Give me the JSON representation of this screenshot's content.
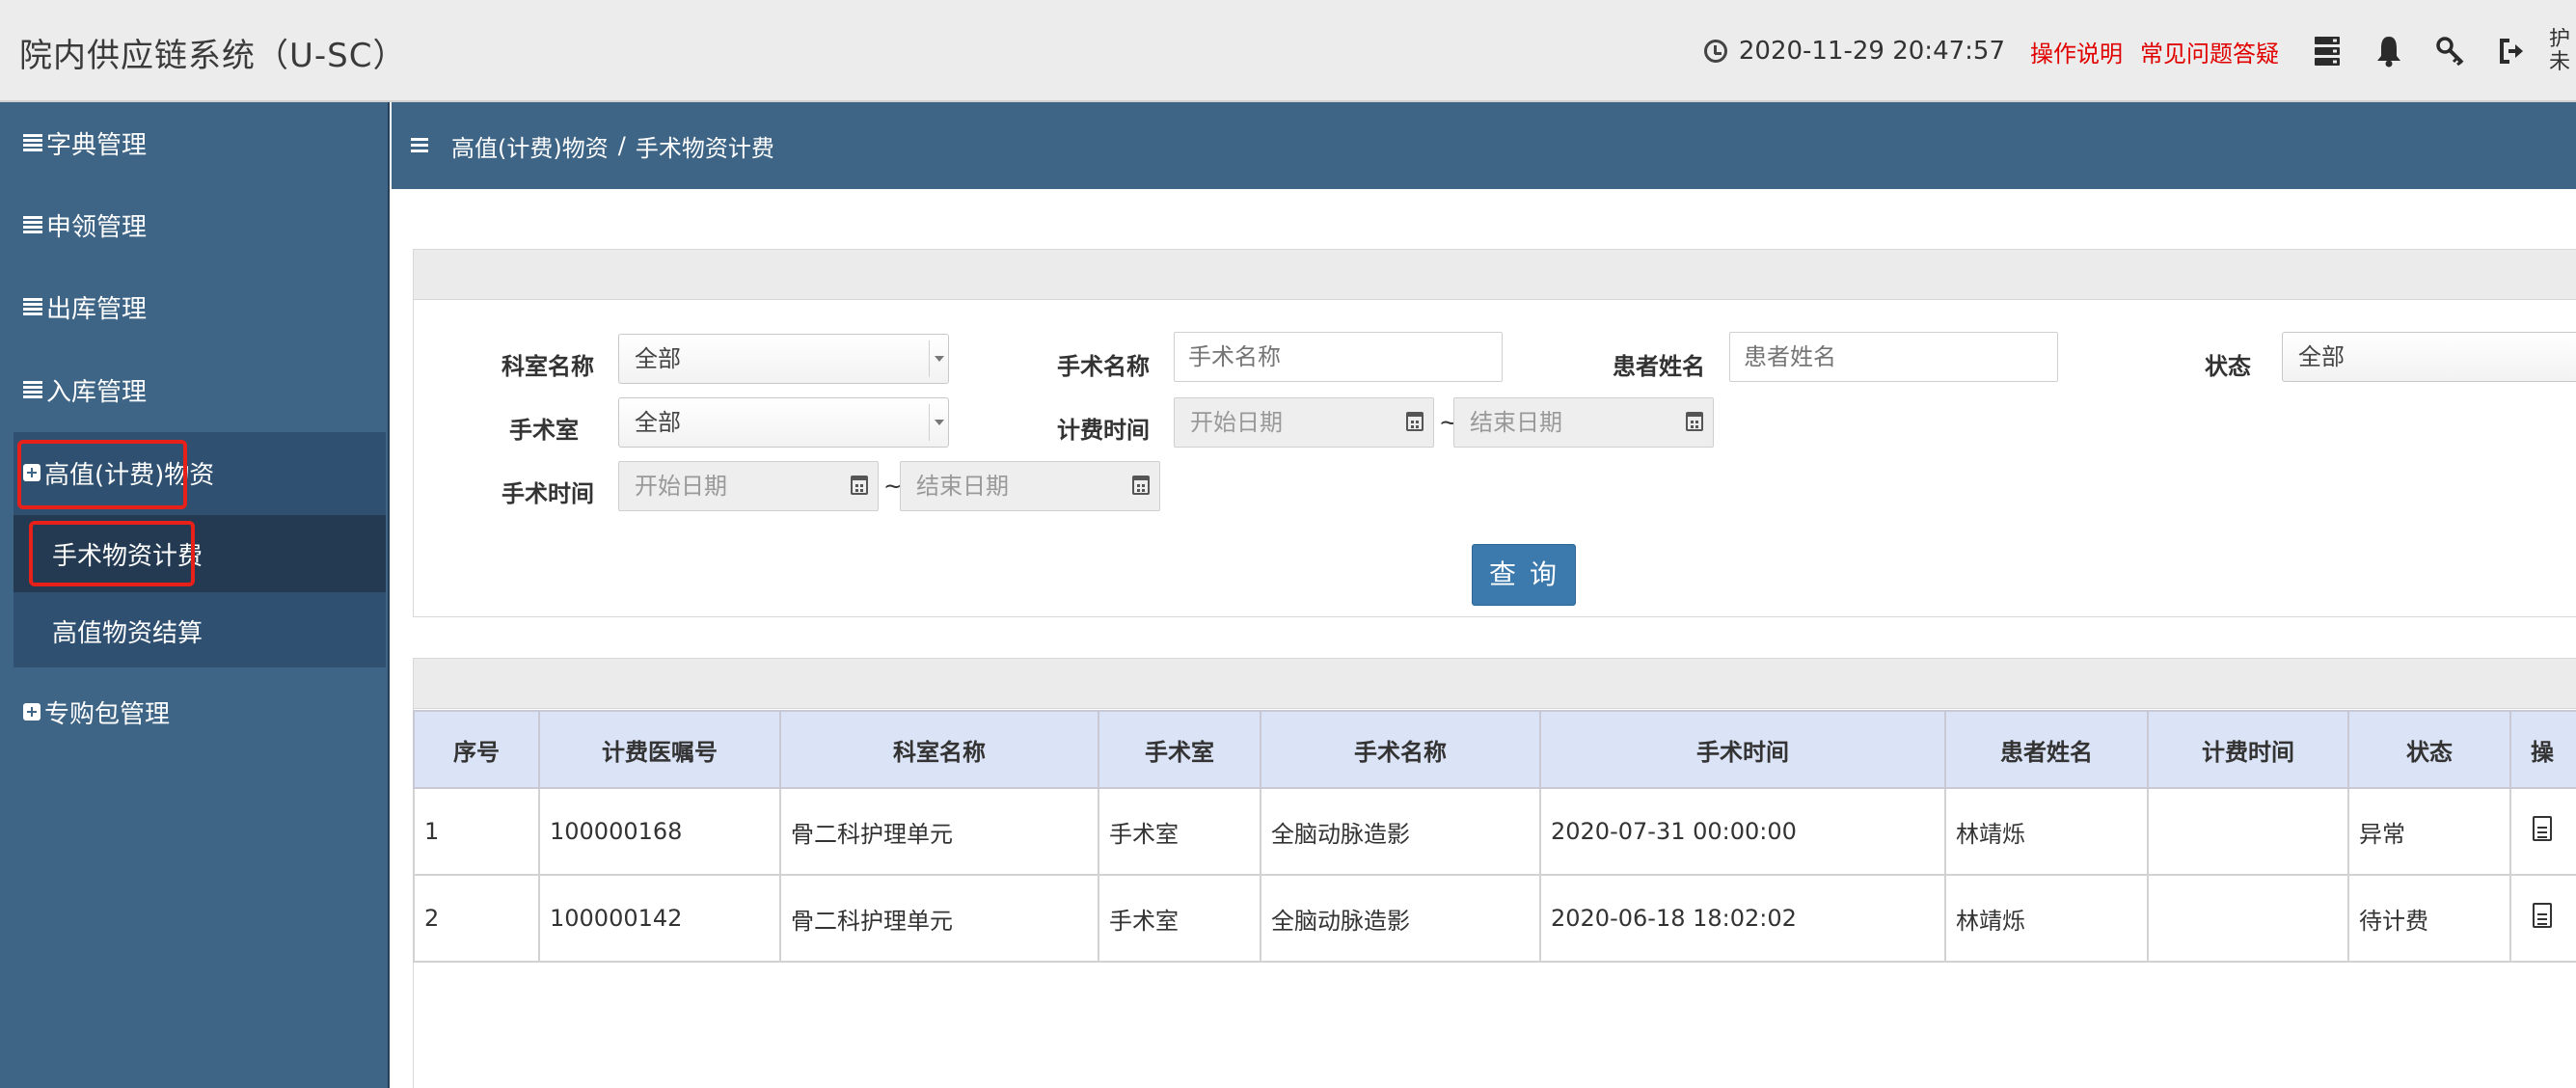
{
  "header": {
    "app_title": "院内供应链系统（U-SC）",
    "datetime": "2020-11-29  20:47:57",
    "help_link": "操作说明",
    "faq_link": "常见问题答疑",
    "user_tail": "护 未",
    "icons": [
      "clock-icon",
      "server-icon",
      "bell-icon",
      "key-icon",
      "logout-icon"
    ]
  },
  "sidebar": {
    "items": [
      {
        "label": "字典管理"
      },
      {
        "label": "申领管理"
      },
      {
        "label": "出库管理"
      },
      {
        "label": "入库管理"
      },
      {
        "label": "高值(计费)物资"
      },
      {
        "label": "手术物资计费"
      },
      {
        "label": "高值物资结算"
      },
      {
        "label": "专购包管理"
      }
    ]
  },
  "breadcrumb": {
    "parent": "高值(计费)物资",
    "separator": "/",
    "current": "手术物资计费"
  },
  "filters": {
    "dept_label": "科室名称",
    "dept_value": "全部",
    "surgery_name_label": "手术名称",
    "surgery_name_placeholder": "手术名称",
    "patient_label": "患者姓名",
    "patient_placeholder": "患者姓名",
    "status_label": "状态",
    "status_value": "全部",
    "or_label": "手术室",
    "or_value": "全部",
    "billing_time_label": "计费时间",
    "billing_start": "开始日期",
    "billing_end": "结束日期",
    "surgery_time_label": "手术时间",
    "surgery_start": "开始日期",
    "surgery_end": "结束日期",
    "range_sep": "~",
    "query_button": "查询"
  },
  "table": {
    "columns": [
      "序号",
      "计费医嘱号",
      "科室名称",
      "手术室",
      "手术名称",
      "手术时间",
      "患者姓名",
      "计费时间",
      "状态",
      "操"
    ],
    "rows": [
      [
        "1",
        "100000168",
        "骨二科护理单元",
        "手术室",
        "全脑动脉造影",
        "2020-07-31 00:00:00",
        "林靖烁",
        "",
        "异常"
      ],
      [
        "2",
        "100000142",
        "骨二科护理单元",
        "手术室",
        "全脑动脉造影",
        "2020-06-18 18:02:02",
        "林靖烁",
        "",
        "待计费"
      ]
    ]
  },
  "colors": {
    "sidebar": "#3f6586",
    "header_bg": "#ececec",
    "highlight_red": "#e8201a",
    "link_red": "#e00000",
    "button_blue": "#3c79ac",
    "table_header": "#dbe3f6"
  }
}
